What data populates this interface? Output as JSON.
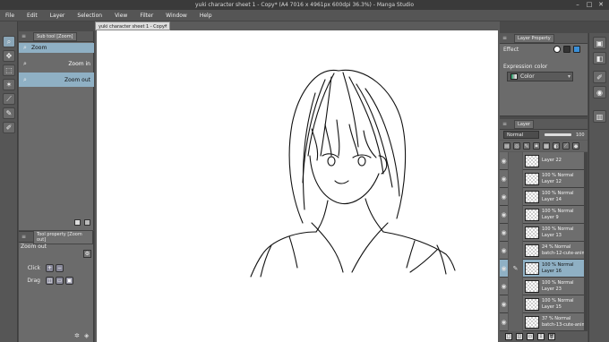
{
  "window": {
    "title": "yuki character sheet 1 - Copy* (A4 7016 x 4961px 600dpi 36.3%) - Manga Studio",
    "controls": [
      "minimize-icon",
      "maximize-icon",
      "close-icon"
    ]
  },
  "menu": [
    "File",
    "Edit",
    "Layer",
    "Selection",
    "View",
    "Filter",
    "Window",
    "Help"
  ],
  "document_tab": {
    "label": "yuki character sheet 1 - Copy*"
  },
  "sub_tool": {
    "header": "Sub tool [Zoom]",
    "group": "Zoom",
    "items": [
      {
        "label": "Zoom in",
        "icon": "magnifier-icon"
      },
      {
        "label": "Zoom out",
        "icon": "magnifier-icon"
      }
    ]
  },
  "tool_property": {
    "header": "Tool property [Zoom out]",
    "name": "Zoom out",
    "rows": [
      {
        "label": "Click"
      },
      {
        "label": "Drag"
      }
    ]
  },
  "layer_property": {
    "header": "Layer Property",
    "effect_label": "Effect",
    "expression_color_label": "Expression color",
    "expression_color_value": "Color"
  },
  "layer_panel": {
    "header": "Layer",
    "blend_mode": "Normal",
    "opacity": "100",
    "layers": [
      {
        "line1": "",
        "line2": "Layer 22",
        "selected": false
      },
      {
        "line1": "100 %  Normal",
        "line2": "Layer 12",
        "selected": false
      },
      {
        "line1": "100 %  Normal",
        "line2": "Layer 14",
        "selected": false
      },
      {
        "line1": "100 %  Normal",
        "line2": "Layer 9",
        "selected": false
      },
      {
        "line1": "100 %  Normal",
        "line2": "Layer 13",
        "selected": false
      },
      {
        "line1": "24 %  Normal",
        "line2": "batch-12-cute-anim",
        "selected": false
      },
      {
        "line1": "100 %  Normal",
        "line2": "Layer 16",
        "selected": true
      },
      {
        "line1": "100 %  Normal",
        "line2": "Layer 23",
        "selected": false
      },
      {
        "line1": "100 %  Normal",
        "line2": "Layer 15",
        "selected": false
      },
      {
        "line1": "37 %  Normal",
        "line2": "batch-13-cute-anim",
        "selected": false
      }
    ]
  }
}
